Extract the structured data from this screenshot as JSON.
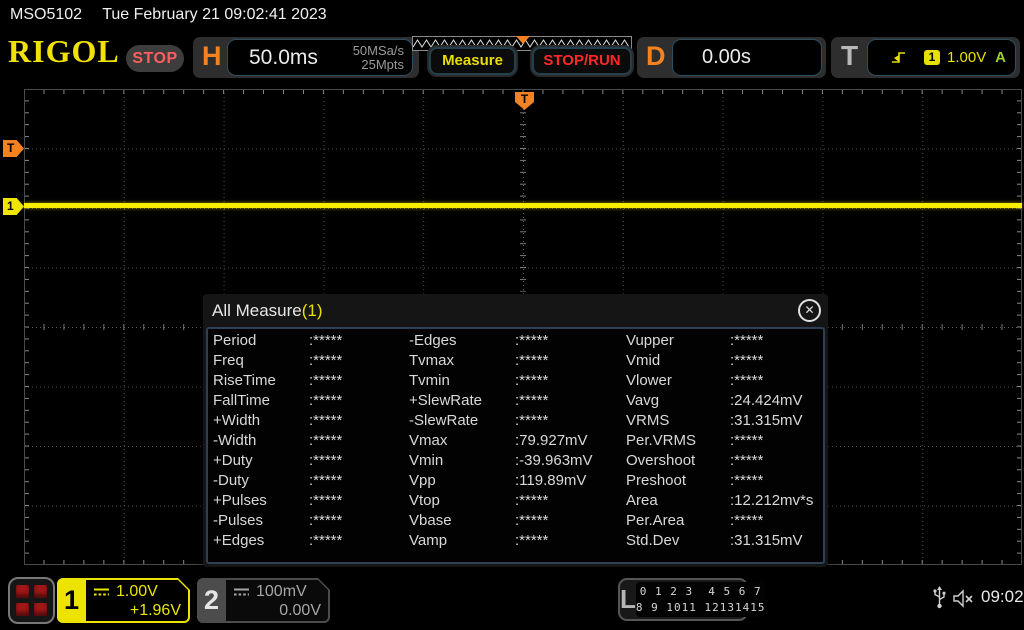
{
  "status_bar": {
    "model": "MSO5102",
    "datetime": "Tue February 21 09:02:41 2023"
  },
  "header": {
    "logo": "RIGOL",
    "run_state": "STOP",
    "horizontal": {
      "label": "H",
      "timebase": "50.0ms",
      "sample_rate": "50MSa/s",
      "mem_depth": "25Mpts"
    },
    "measure_label": "Measure",
    "stop_run_label": "STOP/RUN",
    "delay": {
      "label": "D",
      "value": "0.00s"
    },
    "trigger": {
      "label": "T",
      "source_badge": "1",
      "level": "1.00V",
      "mode": "A"
    }
  },
  "markers": {
    "trigger_level": "T",
    "channel1": "1",
    "trigger_position": "T"
  },
  "measure_panel": {
    "title": "All Measure",
    "count": "(1)",
    "close_glyph": "✕",
    "columns": [
      [
        {
          "label": "Period",
          "value": ":*****"
        },
        {
          "label": "Freq",
          "value": ":*****"
        },
        {
          "label": "RiseTime",
          "value": ":*****"
        },
        {
          "label": "FallTime",
          "value": ":*****"
        },
        {
          "label": "+Width",
          "value": ":*****"
        },
        {
          "label": "-Width",
          "value": ":*****"
        },
        {
          "label": "+Duty",
          "value": ":*****"
        },
        {
          "label": "-Duty",
          "value": ":*****"
        },
        {
          "label": "+Pulses",
          "value": ":*****"
        },
        {
          "label": "-Pulses",
          "value": ":*****"
        },
        {
          "label": "+Edges",
          "value": ":*****"
        }
      ],
      [
        {
          "label": "-Edges",
          "value": ":*****"
        },
        {
          "label": "Tvmax",
          "value": ":*****"
        },
        {
          "label": "Tvmin",
          "value": ":*****"
        },
        {
          "label": "+SlewRate",
          "value": ":*****"
        },
        {
          "label": "-SlewRate",
          "value": ":*****"
        },
        {
          "label": "Vmax",
          "value": ":79.927mV"
        },
        {
          "label": "Vmin",
          "value": ":-39.963mV"
        },
        {
          "label": "Vpp",
          "value": ":119.89mV"
        },
        {
          "label": "Vtop",
          "value": ":*****"
        },
        {
          "label": "Vbase",
          "value": ":*****"
        },
        {
          "label": "Vamp",
          "value": ":*****"
        }
      ],
      [
        {
          "label": "Vupper",
          "value": ":*****"
        },
        {
          "label": "Vmid",
          "value": ":*****"
        },
        {
          "label": "Vlower",
          "value": ":*****"
        },
        {
          "label": "Vavg",
          "value": ":24.424mV"
        },
        {
          "label": "VRMS",
          "value": ":31.315mV"
        },
        {
          "label": "Per.VRMS",
          "value": ":*****"
        },
        {
          "label": "Overshoot",
          "value": ":*****"
        },
        {
          "label": "Preshoot",
          "value": ":*****"
        },
        {
          "label": "Area",
          "value": ":12.212mv*s"
        },
        {
          "label": "Per.Area",
          "value": ":*****"
        },
        {
          "label": "Std.Dev",
          "value": ":31.315mV"
        }
      ]
    ]
  },
  "bottom_bar": {
    "ch1": {
      "number": "1",
      "scale": "1.00V",
      "offset": "+1.96V"
    },
    "ch2": {
      "number": "2",
      "scale": "100mV",
      "offset": "0.00V"
    },
    "logic": {
      "label": "L",
      "row1": "0 1 2 3  4 5 6 7",
      "row2": "8 9 1011 12131415"
    },
    "time": "09:02"
  },
  "colors": {
    "accent_yellow": "#ece400",
    "accent_orange": "#f58220",
    "stop_red": "#ff2828",
    "mode_green": "#9ccd2a",
    "trace_yellow": "#f8ef00"
  }
}
